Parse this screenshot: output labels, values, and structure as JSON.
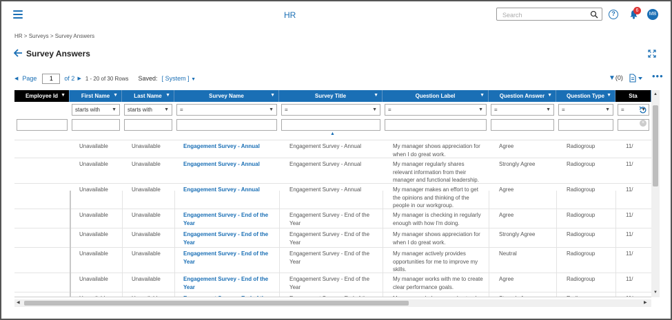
{
  "app": {
    "title": "HR"
  },
  "search": {
    "placeholder": "Search"
  },
  "notifications": {
    "count": "6"
  },
  "user": {
    "initials": "MB"
  },
  "breadcrumb": [
    "HR",
    "Surveys",
    "Survey Answers"
  ],
  "breadcrumb_sep": ">",
  "page": {
    "title": "Survey Answers"
  },
  "pager": {
    "label": "Page",
    "current": "1",
    "of_text": "of 2",
    "rows_text": "1 - 20 of 30 Rows",
    "saved_label": "Saved:",
    "saved_value": "[ System ]"
  },
  "filter": {
    "count_text": "(0)"
  },
  "colors": {
    "header_bg": "#1a6fb5",
    "frozen_header_bg": "#000000",
    "link": "#1a6fb5"
  },
  "columns": [
    {
      "label": "Employee Id",
      "filter_op": "",
      "dark": true
    },
    {
      "label": "First Name",
      "filter_op": "starts with"
    },
    {
      "label": "Last Name",
      "filter_op": "starts with"
    },
    {
      "label": "Survey Name",
      "filter_op": "="
    },
    {
      "label": "Survey Title",
      "filter_op": "="
    },
    {
      "label": "Question Label",
      "filter_op": "="
    },
    {
      "label": "Question Answer",
      "filter_op": "="
    },
    {
      "label": "Question Type",
      "filter_op": "="
    },
    {
      "label": "Sta",
      "filter_op": "=",
      "dark": true
    }
  ],
  "rows": [
    {
      "employee_id": "",
      "first": "Unavailable",
      "last": "Unavailable",
      "survey_name": "Engagement Survey - Annual",
      "survey_title": "Engagement Survey - Annual",
      "question": "My manager shows appreciation for when I do great work.",
      "answer": "Agree",
      "type": "Radiogroup",
      "status": "11/"
    },
    {
      "employee_id": "",
      "first": "Unavailable",
      "last": "Unavailable",
      "survey_name": "Engagement Survey - Annual",
      "survey_title": "Engagement Survey - Annual",
      "question": "My manager regularly shares relevant information from their manager and functional leadership.",
      "answer": "Strongly Agree",
      "type": "Radiogroup",
      "status": "11/"
    },
    {
      "employee_id": "",
      "first": "Unavailable",
      "last": "Unavailable",
      "survey_name": "Engagement Survey - Annual",
      "survey_title": "Engagement Survey - Annual",
      "question": "My manager makes an effort to get the opinions and thinking of the people in our workgroup.",
      "answer": "Agree",
      "type": "Radiogroup",
      "status": "11/"
    },
    {
      "employee_id": "",
      "first": "Unavailable",
      "last": "Unavailable",
      "survey_name": "Engagement Survey - End of the Year",
      "survey_title": "Engagement Survey - End of the Year",
      "question": "My manager is checking in regularly enough with how I'm doing.",
      "answer": "Agree",
      "type": "Radiogroup",
      "status": "11/"
    },
    {
      "employee_id": "",
      "first": "Unavailable",
      "last": "Unavailable",
      "survey_name": "Engagement Survey - End of the Year",
      "survey_title": "Engagement Survey - End of the Year",
      "question": "My manager shows appreciation for when I do great work.",
      "answer": "Strongly Agree",
      "type": "Radiogroup",
      "status": "11/"
    },
    {
      "employee_id": "",
      "first": "Unavailable",
      "last": "Unavailable",
      "survey_name": "Engagement Survey - End of the Year",
      "survey_title": "Engagement Survey - End of the Year",
      "question": "My manager actively provides opportunities for me to improve my skills.",
      "answer": "Neutral",
      "type": "Radiogroup",
      "status": "11/"
    },
    {
      "employee_id": "",
      "first": "Unavailable",
      "last": "Unavailable",
      "survey_name": "Engagement Survey - End of the Year",
      "survey_title": "Engagement Survey - End of the Year",
      "question": "My manager works with me to create clear performance goals.",
      "answer": "Agree",
      "type": "Radiogroup",
      "status": "11/"
    },
    {
      "employee_id": "",
      "first": "Unavailable",
      "last": "Unavailable",
      "survey_name": "Engagement Survey - End of the",
      "survey_title": "Engagement Survey - End of the Year",
      "question": "My manager helps me understand",
      "answer": "Strongly Agree",
      "type": "Radiogroup",
      "status": "11/"
    }
  ]
}
